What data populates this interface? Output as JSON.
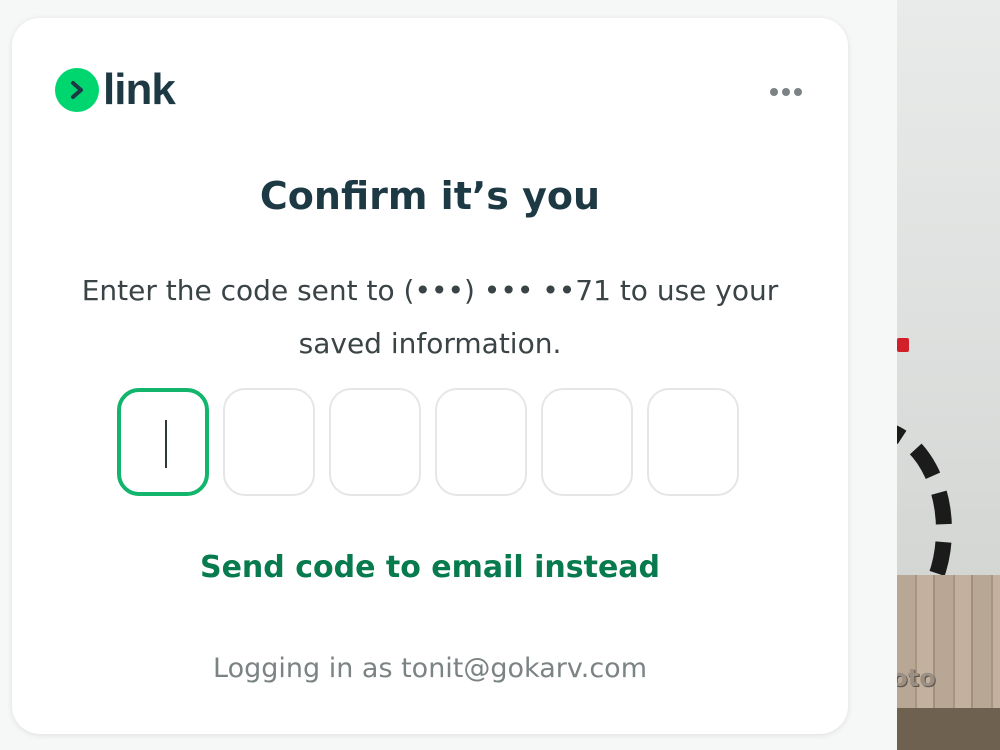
{
  "brand": {
    "logo_text": "link",
    "accent_color": "#00d66f",
    "text_color": "#1d3944"
  },
  "header": {
    "menu_icon": "more-horizontal-icon"
  },
  "dialog": {
    "title": "Confirm it’s you",
    "subtitle": "Enter the code sent to (•••) ••• ••71 to use your saved information.",
    "code_length": 6,
    "code_digits": [
      "",
      "",
      "",
      "",
      "",
      ""
    ],
    "active_digit_index": 0,
    "alternate_link": "Send code to email instead",
    "footer": "Logging in as tonit@gokarv.com",
    "link_color": "#077a4e",
    "focus_color": "#12b56b"
  },
  "background": {
    "watermark_text": "loto"
  }
}
